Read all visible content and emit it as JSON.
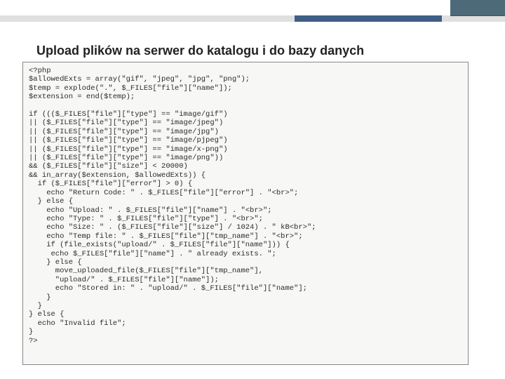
{
  "slide": {
    "heading": "Upload plików na serwer do katalogu i do bazy danych"
  },
  "code": {
    "lines": [
      "<?php",
      "$allowedExts = array(\"gif\", \"jpeg\", \"jpg\", \"png\");",
      "$temp = explode(\".\", $_FILES[\"file\"][\"name\"]);",
      "$extension = end($temp);",
      "",
      "if ((($_FILES[\"file\"][\"type\"] == \"image/gif\")",
      "|| ($_FILES[\"file\"][\"type\"] == \"image/jpeg\")",
      "|| ($_FILES[\"file\"][\"type\"] == \"image/jpg\")",
      "|| ($_FILES[\"file\"][\"type\"] == \"image/pjpeg\")",
      "|| ($_FILES[\"file\"][\"type\"] == \"image/x-png\")",
      "|| ($_FILES[\"file\"][\"type\"] == \"image/png\"))",
      "&& ($_FILES[\"file\"][\"size\"] < 20000)",
      "&& in_array($extension, $allowedExts)) {",
      "  if ($_FILES[\"file\"][\"error\"] > 0) {",
      "    echo \"Return Code: \" . $_FILES[\"file\"][\"error\"] . \"<br>\";",
      "  } else {",
      "    echo \"Upload: \" . $_FILES[\"file\"][\"name\"] . \"<br>\";",
      "    echo \"Type: \" . $_FILES[\"file\"][\"type\"] . \"<br>\";",
      "    echo \"Size: \" . ($_FILES[\"file\"][\"size\"] / 1024) . \" kB<br>\";",
      "    echo \"Temp file: \" . $_FILES[\"file\"][\"tmp_name\"] . \"<br>\";",
      "    if (file_exists(\"upload/\" . $_FILES[\"file\"][\"name\"])) {",
      "     echo $_FILES[\"file\"][\"name\"] . \" already exists. \";",
      "    } else {",
      "      move_uploaded_file($_FILES[\"file\"][\"tmp_name\"],",
      "      \"upload/\" . $_FILES[\"file\"][\"name\"]);",
      "      echo \"Stored in: \" . \"upload/\" . $_FILES[\"file\"][\"name\"];",
      "    }",
      "  }",
      "} else {",
      "  echo \"Invalid file\";",
      "}",
      "?>"
    ]
  }
}
